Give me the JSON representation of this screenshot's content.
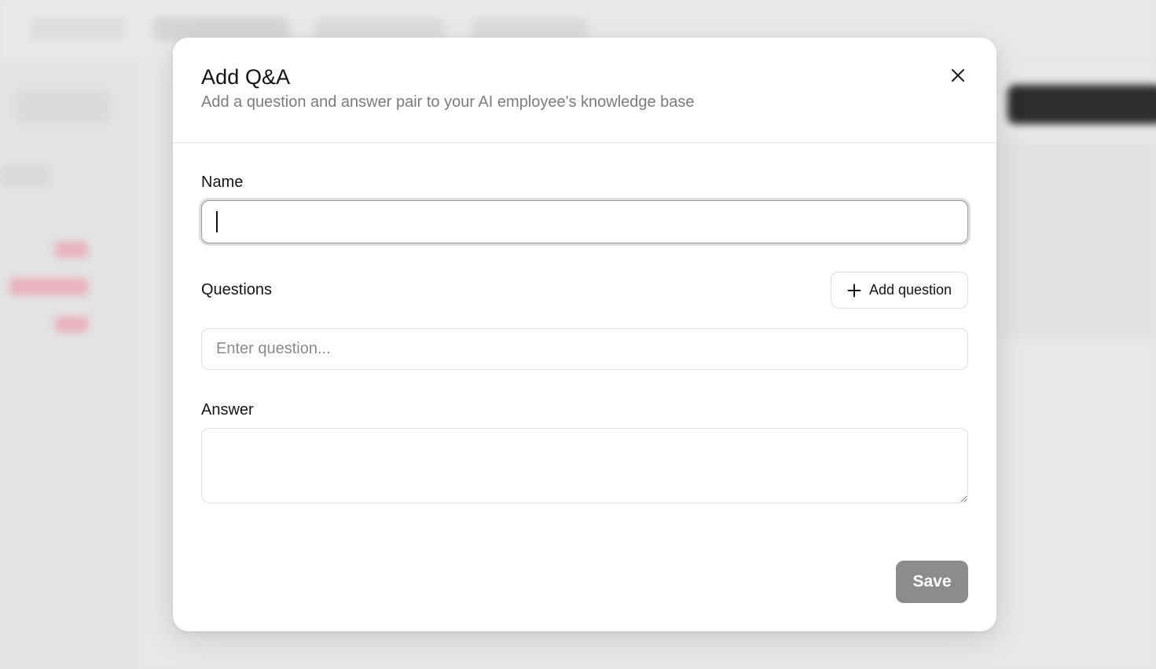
{
  "modal": {
    "title": "Add Q&A",
    "subtitle": "Add a question and answer pair to your AI employee's knowledge base",
    "close_icon": "close-icon"
  },
  "form": {
    "name_label": "Name",
    "name_value": "",
    "questions_label": "Questions",
    "add_question_label": "Add question",
    "add_question_icon": "plus-icon",
    "question_placeholder": "Enter question...",
    "question_value": "",
    "answer_label": "Answer",
    "answer_value": "",
    "save_label": "Save"
  },
  "colors": {
    "save_button_disabled": "#8c8c8c",
    "subtitle_text": "#7c7c7c",
    "modal_background": "#ffffff"
  }
}
